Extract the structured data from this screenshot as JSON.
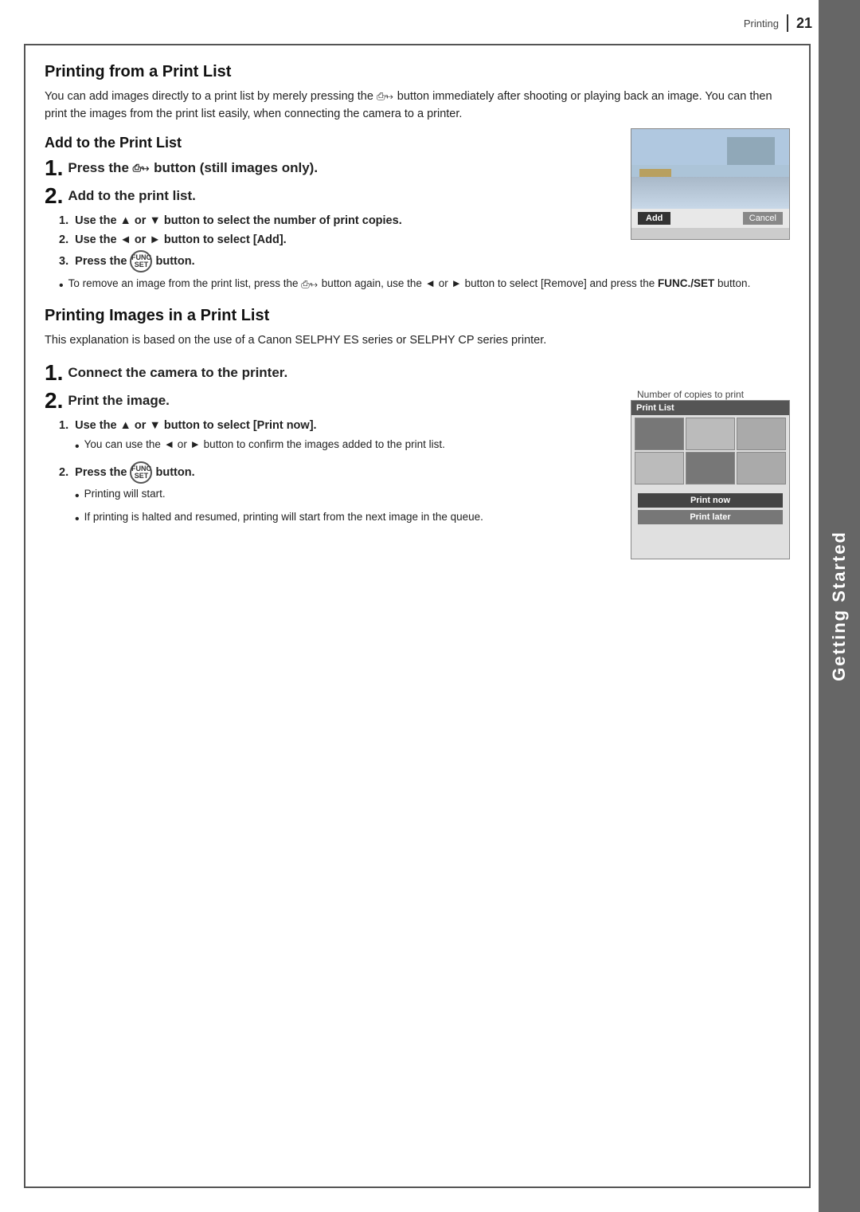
{
  "header": {
    "section": "Printing",
    "divider": "|",
    "page": "21"
  },
  "sidebar": {
    "label": "Getting Started"
  },
  "main": {
    "title": "Printing from a Print List",
    "intro": "You can add images directly to a print list by merely pressing the  button immediately after shooting or playing back an image. You can then print the images from the print list easily, when connecting the camera to a printer.",
    "addTitle": "Add to the Print List",
    "step1": {
      "num": "1.",
      "text": "Press the   button (still images only)."
    },
    "step2": {
      "num": "2.",
      "text": "Add to the print list."
    },
    "subSteps": [
      {
        "num": "1.",
        "text": "Use the ▲ or ▼ button to select the number of print copies."
      },
      {
        "num": "2.",
        "text": "Use the ◄ or ► button to select [Add]."
      },
      {
        "num": "3.",
        "text": "Press the  button."
      }
    ],
    "bulletNote1": "To remove an image from the print list, press the  button again, use the ◄ or ► button to select [Remove] and press the FUNC./SET button.",
    "printingTitle": "Printing Images in a Print List",
    "printingIntro": "This explanation is based on the use of a Canon SELPHY ES series or SELPHY CP series printer.",
    "connectStep": {
      "num": "1.",
      "text": "Connect the camera to the printer."
    },
    "printStep": {
      "num": "2.",
      "text": "Print the image."
    },
    "printSubSteps": [
      {
        "num": "1.",
        "text": "Use the ▲ or ▼ button to select [Print now]."
      }
    ],
    "copiesLabel": "Number of copies to print",
    "printBullet1": "You can use the ◄ or ► button to confirm the images added to the print list.",
    "printSubStep2": {
      "num": "2.",
      "text": "Press the  button."
    },
    "printBullet2": "Printing will start.",
    "printBullet3": "If printing is halted and resumed, printing will start from the next image in the queue.",
    "addBtn": "Add",
    "cancelBtn": "Cancel",
    "printListHeader": "Print List",
    "printNowBtn": "Print now",
    "printLaterBtn": "Print later"
  }
}
